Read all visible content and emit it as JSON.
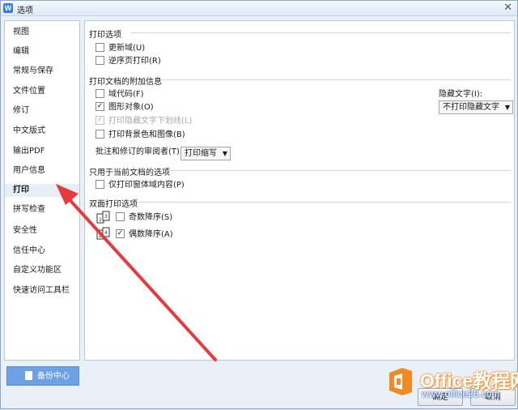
{
  "window": {
    "title": "选项",
    "app_icon": "W",
    "close_icon": "close-icon"
  },
  "sidebar": {
    "items": [
      {
        "label": "视图"
      },
      {
        "label": "编辑"
      },
      {
        "label": "常规与保存"
      },
      {
        "label": "文件位置"
      },
      {
        "label": "修订"
      },
      {
        "label": "中文版式"
      },
      {
        "label": "输出PDF"
      },
      {
        "label": "用户信息"
      },
      {
        "label": "打印",
        "selected": true
      },
      {
        "label": "拼写检查"
      },
      {
        "label": "安全性"
      },
      {
        "label": "信任中心"
      },
      {
        "label": "自定义功能区"
      },
      {
        "label": "快速访问工具栏"
      }
    ]
  },
  "print_options": {
    "title": "打印选项",
    "update_fields": {
      "label": "更新域(U)",
      "checked": false
    },
    "reverse_order": {
      "label": "逆序页打印(R)",
      "checked": false
    }
  },
  "attached_info": {
    "title": "打印文档的附加信息",
    "field_codes": {
      "label": "域代码(F)",
      "checked": false
    },
    "drawing_objects": {
      "label": "图形对象(O)",
      "checked": true
    },
    "hidden_underline": {
      "label": "打印隐藏文字下划线(L)",
      "checked": true,
      "disabled": true
    },
    "background": {
      "label": "打印背景色和图像(B)",
      "checked": false
    },
    "reviewer_label": "批注和修订的审阅者(T)：",
    "reviewer_value": "打印缩写",
    "hidden_text_label": "隐藏文字(I):",
    "hidden_text_value": "不打印隐藏文字"
  },
  "current_doc": {
    "title": "只用于当前文档的选项",
    "form_data_only": {
      "label": "仅打印窗体域内容(P)",
      "checked": false
    }
  },
  "duplex": {
    "title": "双面打印选项",
    "odd_reverse": {
      "label": "奇数降序(S)",
      "checked": false
    },
    "even_reverse": {
      "label": "偶数降序(A)",
      "checked": true
    }
  },
  "footer": {
    "backup_label": "备份中心",
    "ok_label": "确定",
    "cancel_label": "取消"
  },
  "watermark": {
    "brand": "Office教程网",
    "url": "www.office26.com"
  },
  "colors": {
    "accent_arrow": "#e8393c",
    "backup_button": "#6ea0e4",
    "watermark_orange": "#f38a1f"
  }
}
